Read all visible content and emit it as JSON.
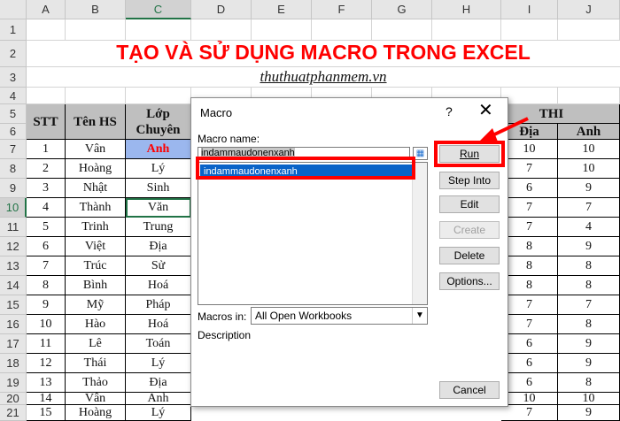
{
  "columns": [
    "A",
    "B",
    "C",
    "D",
    "E",
    "F",
    "G",
    "H",
    "I",
    "J"
  ],
  "selected_column": "C",
  "rows": [
    "1",
    "2",
    "3",
    "4",
    "5",
    "6",
    "7",
    "8",
    "9",
    "10",
    "11",
    "12",
    "13",
    "14",
    "15",
    "16",
    "17",
    "18",
    "19",
    "20",
    "21"
  ],
  "selected_row": "10",
  "title": "TẠO VÀ SỬ DỤNG MACRO TRONG EXCEL",
  "subtitle": "thuthuatphanmem.vn",
  "table_headers": {
    "stt": "STT",
    "ten": "Tên HS",
    "lop": "Lớp Chuyên",
    "thi": "THI",
    "dia": "Địa",
    "anh": "Anh"
  },
  "students": [
    {
      "stt": "1",
      "ten": "Vân",
      "lop": "Anh",
      "dia": "10",
      "anh": "10"
    },
    {
      "stt": "2",
      "ten": "Hoàng",
      "lop": "Lý",
      "dia": "7",
      "anh": "10"
    },
    {
      "stt": "3",
      "ten": "Nhật",
      "lop": "Sinh",
      "dia": "6",
      "anh": "9"
    },
    {
      "stt": "4",
      "ten": "Thành",
      "lop": "Văn",
      "dia": "7",
      "anh": "7"
    },
    {
      "stt": "5",
      "ten": "Trinh",
      "lop": "Trung",
      "dia": "7",
      "anh": "4"
    },
    {
      "stt": "6",
      "ten": "Việt",
      "lop": "Địa",
      "dia": "8",
      "anh": "9"
    },
    {
      "stt": "7",
      "ten": "Trúc",
      "lop": "Sử",
      "dia": "8",
      "anh": "8"
    },
    {
      "stt": "8",
      "ten": "Bình",
      "lop": "Hoá",
      "dia": "8",
      "anh": "8"
    },
    {
      "stt": "9",
      "ten": "Mỹ",
      "lop": "Pháp",
      "dia": "7",
      "anh": "7"
    },
    {
      "stt": "10",
      "ten": "Hào",
      "lop": "Hoá",
      "dia": "7",
      "anh": "8"
    },
    {
      "stt": "11",
      "ten": "Lê",
      "lop": "Toán",
      "dia": "6",
      "anh": "9"
    },
    {
      "stt": "12",
      "ten": "Thái",
      "lop": "Lý",
      "dia": "6",
      "anh": "9"
    },
    {
      "stt": "13",
      "ten": "Thảo",
      "lop": "Địa",
      "dia": "6",
      "anh": "8"
    },
    {
      "stt": "14",
      "ten": "Vân",
      "lop": "Anh",
      "dia": "10",
      "anh": "10"
    },
    {
      "stt": "15",
      "ten": "Hoàng",
      "lop": "Lý",
      "dia": "7",
      "anh": "9"
    }
  ],
  "dialog": {
    "title": "Macro",
    "help": "?",
    "close": "✕",
    "macro_name_label": "Macro name:",
    "macro_name_value": "indammaudonenxanh",
    "list_items": [
      "indammaudonenxanh"
    ],
    "macros_in_label": "Macros in:",
    "macros_in_value": "All Open Workbooks",
    "description_label": "Description",
    "buttons": {
      "run": "Run",
      "step_into": "Step Into",
      "edit": "Edit",
      "create": "Create",
      "delete": "Delete",
      "options": "Options...",
      "cancel": "Cancel"
    }
  },
  "colors": {
    "accent_red": "#ff0000",
    "selection_blue": "#0a63c8",
    "header_fill": "#bfbfbf"
  }
}
